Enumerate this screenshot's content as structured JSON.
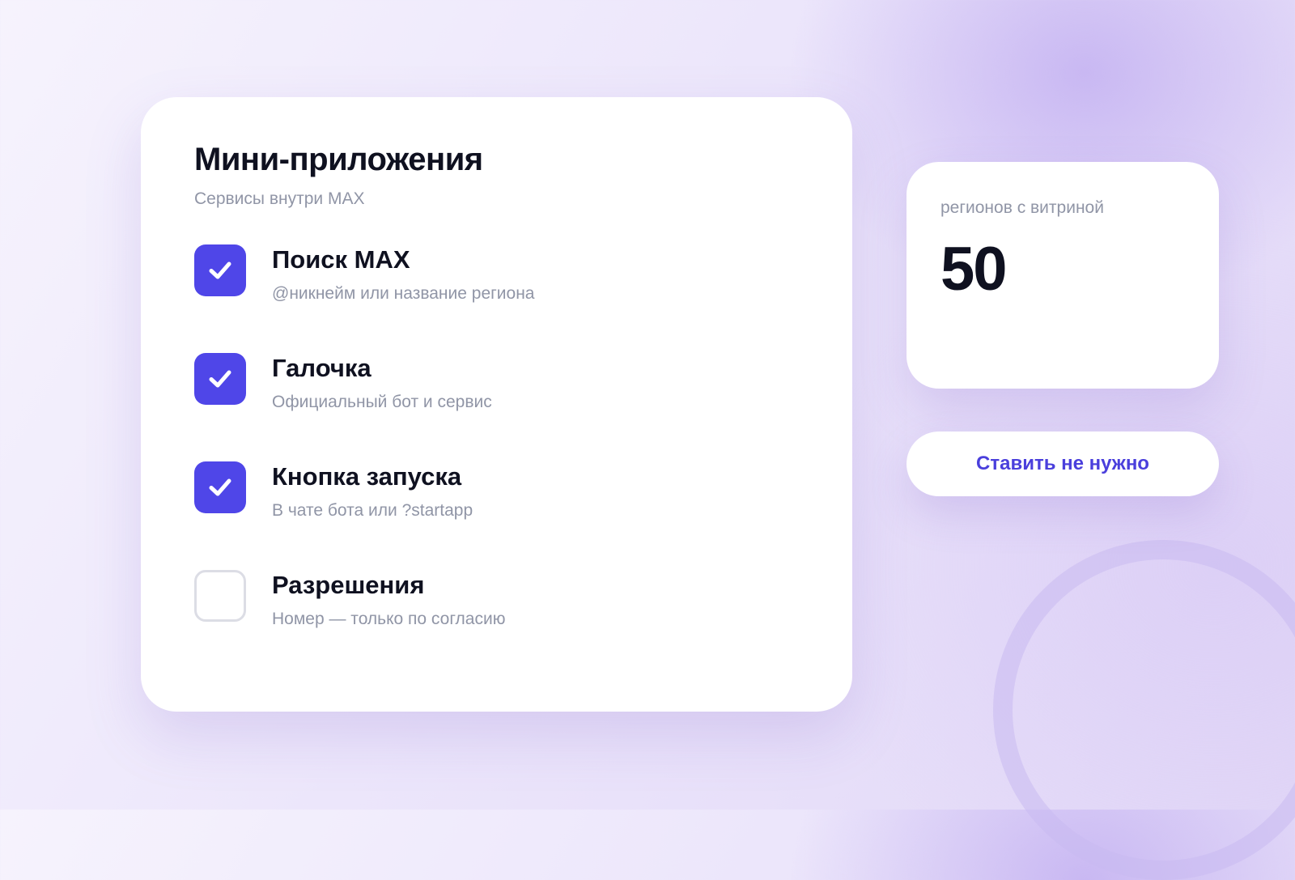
{
  "mini_apps": {
    "title": "Мини-приложения",
    "subtitle": "Сервисы внутри MAX",
    "items": [
      {
        "label": "Поиск MAX",
        "description": "@никнейм или название региона",
        "checked": true
      },
      {
        "label": "Галочка",
        "description": "Официальный бот и сервис",
        "checked": true
      },
      {
        "label": "Кнопка запуска",
        "description": "В чате бота или ?startapp",
        "checked": true
      },
      {
        "label": "Разрешения",
        "description": "Номер — только по согласию",
        "checked": false
      }
    ]
  },
  "stat": {
    "label": "регионов с витриной",
    "value": "50"
  },
  "action": {
    "label": "Ставить не нужно"
  },
  "colors": {
    "accent": "#4f46e8",
    "button_text": "#4a3fdc",
    "muted_text": "#9095a6",
    "heading_text": "#0f1120"
  },
  "icons": {
    "checked": "checkmark-icon"
  }
}
